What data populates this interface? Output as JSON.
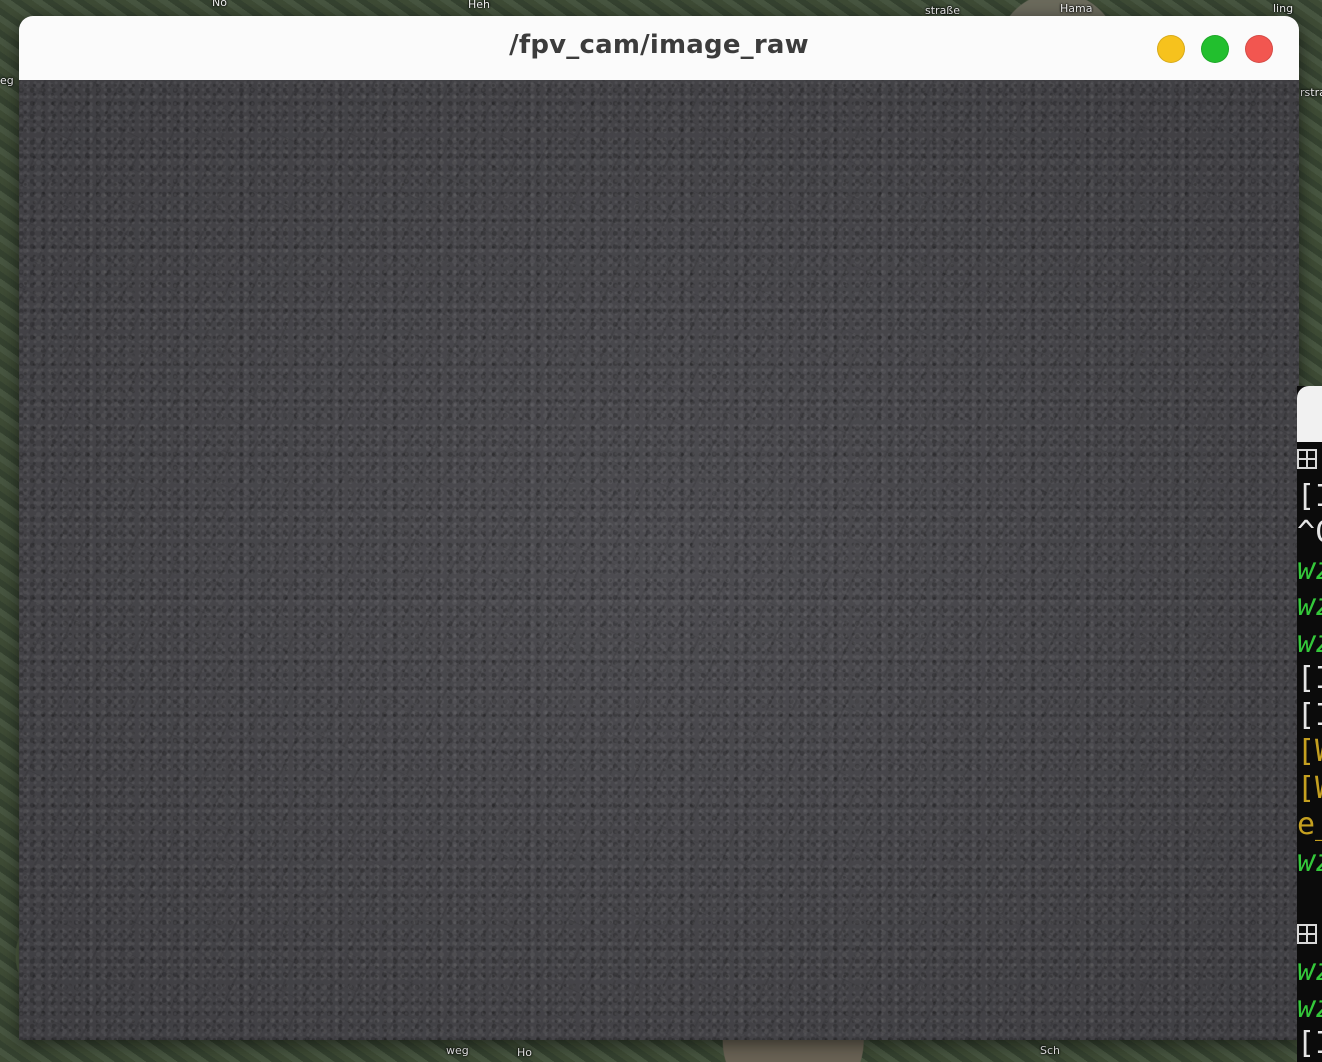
{
  "window": {
    "title": "/fpv_cam/image_raw"
  },
  "image": {
    "content": "Ground texture camera feed"
  },
  "background_map": {
    "labels": [
      "Nö",
      "eg",
      "Heh",
      "straße",
      "Hama",
      "ling",
      "rstraße",
      "weg",
      "Ho",
      "Sch"
    ]
  },
  "terminal": {
    "lines": [
      {
        "text": "▦",
        "style": "icon"
      },
      {
        "text": "[I",
        "style": "white"
      },
      {
        "text": "^C",
        "style": "white"
      },
      {
        "text": "wz",
        "style": "green"
      },
      {
        "text": "wz",
        "style": "green"
      },
      {
        "text": "wz",
        "style": "green"
      },
      {
        "text": "[I",
        "style": "white"
      },
      {
        "text": "[I",
        "style": "white"
      },
      {
        "text": "[W",
        "style": "yellow"
      },
      {
        "text": "[W",
        "style": "yellow"
      },
      {
        "text": "e_",
        "style": "yellow"
      },
      {
        "text": "wz",
        "style": "green"
      },
      {
        "text": "",
        "style": "white"
      },
      {
        "text": "▦",
        "style": "icon"
      },
      {
        "text": "wz",
        "style": "green"
      },
      {
        "text": "wz",
        "style": "green"
      },
      {
        "text": "[I",
        "style": "white"
      }
    ]
  },
  "colors": {
    "minimize": "#f6c21d",
    "maximize": "#22bf2e",
    "close": "#f25650"
  }
}
